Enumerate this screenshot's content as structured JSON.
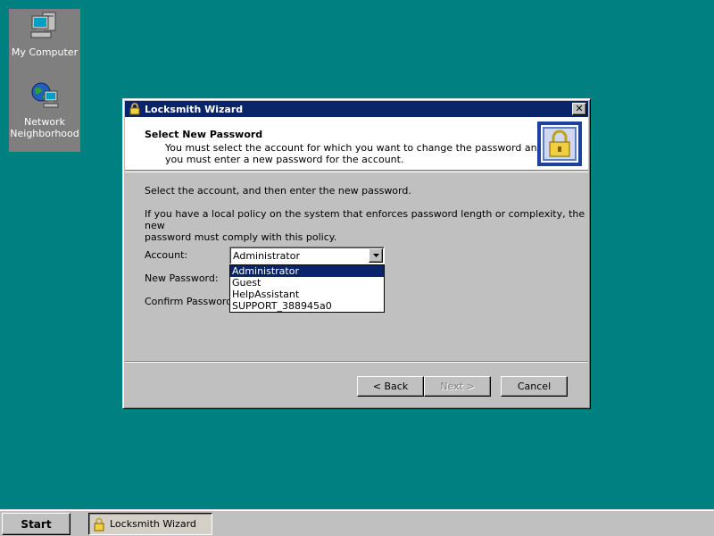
{
  "desktop": {
    "icons": [
      {
        "label": "My Computer"
      },
      {
        "label_line1": "Network",
        "label_line2": "Neighborhood"
      }
    ]
  },
  "window": {
    "title": "Locksmith Wizard",
    "close_label": "✕",
    "header": {
      "title": "Select New Password",
      "subtitle_line1": "You must select the account for which you want to change the password and",
      "subtitle_line2": "you must enter a new password for the account."
    },
    "body": {
      "instruction": "Select the account, and then enter the new password.",
      "policy_line1": "If you have a local policy on the system that enforces password length or complexity, the new",
      "policy_line2": "password must comply with this policy."
    },
    "fields": {
      "account_label": "Account:",
      "new_password_label": "New Password:",
      "confirm_password_label": "Confirm Password:"
    },
    "account_combo": {
      "selected": "Administrator",
      "options": [
        "Administrator",
        "Guest",
        "HelpAssistant",
        "SUPPORT_388945a0"
      ]
    },
    "buttons": {
      "back": "< Back",
      "next": "Next >",
      "cancel": "Cancel"
    }
  },
  "taskbar": {
    "start_label": "Start",
    "task_label": "Locksmith Wizard"
  },
  "icons": {
    "computer": "computer-icon",
    "network": "network-neighborhood-icon",
    "wizard": "padlock-icon"
  },
  "colors": {
    "desktop": "#008080",
    "titlebar": "#0a246a",
    "face": "#c0c0c0",
    "selection": "#0a246a"
  }
}
